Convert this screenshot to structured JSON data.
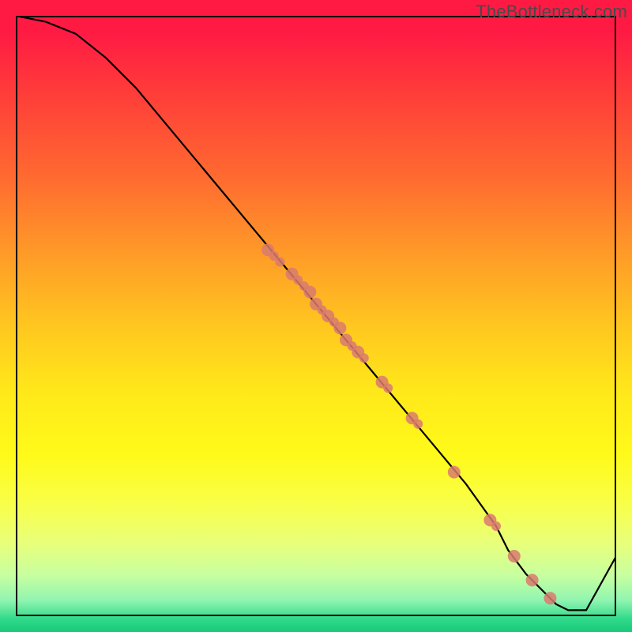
{
  "attribution": "TheBottleneck.com",
  "chart_data": {
    "type": "line",
    "title": "",
    "xlabel": "",
    "ylabel": "",
    "xlim": [
      0,
      100
    ],
    "ylim": [
      0,
      100
    ],
    "grid": false,
    "legend": false,
    "series": [
      {
        "name": "curve",
        "color": "#000000",
        "x": [
          0,
          5,
          10,
          15,
          20,
          25,
          30,
          35,
          40,
          45,
          50,
          55,
          60,
          65,
          70,
          75,
          80,
          82,
          85,
          88,
          90,
          92,
          95,
          100
        ],
        "y": [
          100,
          99,
          97,
          93,
          88,
          82,
          76,
          70,
          64,
          58,
          52,
          46,
          40,
          34,
          28,
          22,
          15,
          11,
          7,
          4,
          2,
          1,
          1,
          10
        ]
      }
    ],
    "scatter_points": {
      "name": "markers",
      "color": "#d97a6e",
      "radius_small": 6,
      "radius_large": 8,
      "points": [
        {
          "x": 42,
          "y": 61,
          "r": 8
        },
        {
          "x": 43,
          "y": 60,
          "r": 6
        },
        {
          "x": 44,
          "y": 59,
          "r": 6
        },
        {
          "x": 46,
          "y": 57,
          "r": 8
        },
        {
          "x": 47,
          "y": 56,
          "r": 6
        },
        {
          "x": 48,
          "y": 55,
          "r": 6
        },
        {
          "x": 49,
          "y": 54,
          "r": 8
        },
        {
          "x": 50,
          "y": 52,
          "r": 8
        },
        {
          "x": 51,
          "y": 51,
          "r": 6
        },
        {
          "x": 52,
          "y": 50,
          "r": 8
        },
        {
          "x": 53,
          "y": 49,
          "r": 6
        },
        {
          "x": 54,
          "y": 48,
          "r": 8
        },
        {
          "x": 55,
          "y": 46,
          "r": 8
        },
        {
          "x": 56,
          "y": 45,
          "r": 6
        },
        {
          "x": 57,
          "y": 44,
          "r": 8
        },
        {
          "x": 58,
          "y": 43,
          "r": 6
        },
        {
          "x": 61,
          "y": 39,
          "r": 8
        },
        {
          "x": 62,
          "y": 38,
          "r": 6
        },
        {
          "x": 66,
          "y": 33,
          "r": 8
        },
        {
          "x": 67,
          "y": 32,
          "r": 6
        },
        {
          "x": 73,
          "y": 24,
          "r": 8
        },
        {
          "x": 79,
          "y": 16,
          "r": 8
        },
        {
          "x": 80,
          "y": 15,
          "r": 6
        },
        {
          "x": 83,
          "y": 10,
          "r": 8
        },
        {
          "x": 86,
          "y": 6,
          "r": 8
        },
        {
          "x": 89,
          "y": 3,
          "r": 8
        }
      ]
    }
  }
}
